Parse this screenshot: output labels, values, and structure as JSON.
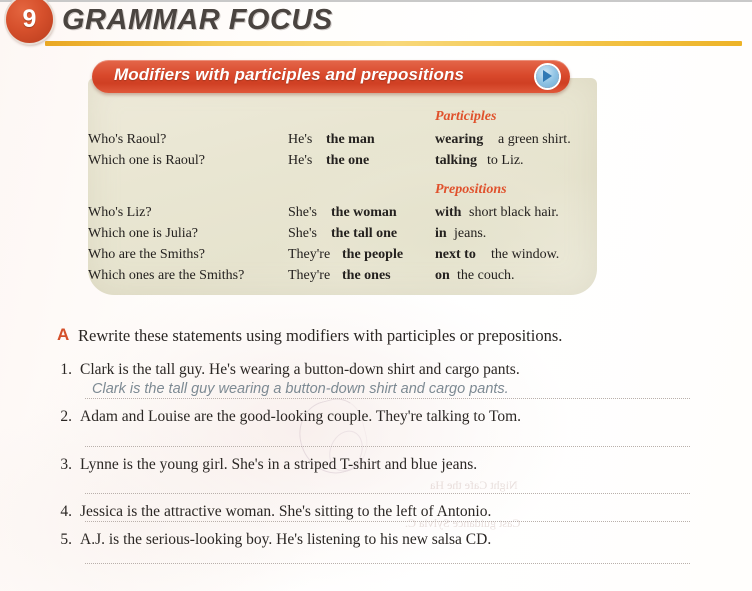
{
  "header": {
    "unit_number": "9",
    "title": "GRAMMAR FOCUS",
    "accent_color": "#d4502a",
    "rule_color": "#f0bb3a"
  },
  "grammar_box": {
    "banner_label": "Modifiers with participles and prepositions",
    "banner_color": "#d9492c",
    "audio_icon": "play-icon",
    "column_headings": {
      "participles": "Participles",
      "prepositions": "Prepositions"
    },
    "block_participles": [
      {
        "question": "Who's Raoul?",
        "subject": "He's ",
        "noun": "the man",
        "modifier_bold": "wearing",
        "modifier_rest": " a green shirt."
      },
      {
        "question": "Which one is Raoul?",
        "subject": "He's ",
        "noun": "the one",
        "modifier_bold": "talking",
        "modifier_rest": " to Liz."
      }
    ],
    "block_prepositions": [
      {
        "question": "Who's Liz?",
        "subject": "She's ",
        "noun": "the woman",
        "modifier_bold": "with",
        "modifier_rest": " short black hair."
      },
      {
        "question": "Which one is Julia?",
        "subject": "She's ",
        "noun": "the tall one",
        "modifier_bold": "in",
        "modifier_rest": " jeans."
      },
      {
        "question": "Who are the Smiths?",
        "subject": "They're ",
        "noun": "the people",
        "modifier_bold": "next to",
        "modifier_rest": " the window."
      },
      {
        "question": "Which ones are the Smiths?",
        "subject": "They're ",
        "noun": "the ones",
        "modifier_bold": "on",
        "modifier_rest": " the couch."
      }
    ]
  },
  "exercise": {
    "letter": "A",
    "instruction": "Rewrite these statements using modifiers with participles or prepositions.",
    "items": [
      {
        "number": "1.",
        "text": "Clark is the tall guy. He's wearing a button-down shirt and cargo pants.",
        "answer": "Clark is the tall guy wearing a button-down shirt and cargo pants."
      },
      {
        "number": "2.",
        "text": "Adam and Louise are the good-looking couple. They're talking to Tom.",
        "answer": ""
      },
      {
        "number": "3.",
        "text": "Lynne is the young girl. She's in a striped T-shirt and blue jeans.",
        "answer": ""
      },
      {
        "number": "4.",
        "text": "Jessica is the attractive woman. She's sitting to the left of Antonio.",
        "answer": ""
      },
      {
        "number": "5.",
        "text": "A.J. is the serious-looking boy. He's listening to his new salsa CD.",
        "answer": ""
      }
    ]
  },
  "bleed_through": {
    "line_1": "Night Cafe the Ha",
    "line_2": "Cast guidance Sylvia C."
  }
}
